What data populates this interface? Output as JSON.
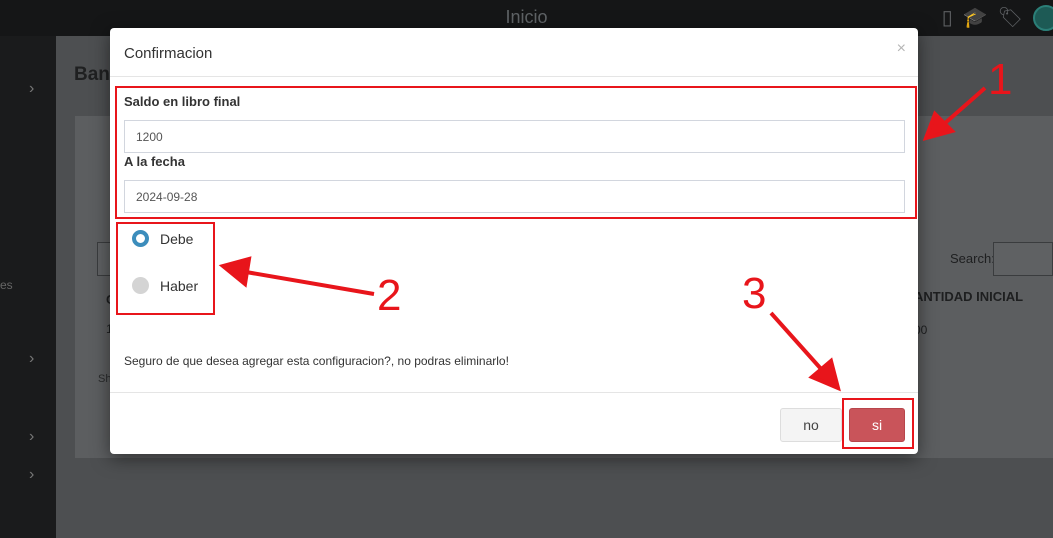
{
  "topbar": {
    "title": "Inicio",
    "icons": [
      "mobile-icon",
      "graduation-cap-icon",
      "tags-icon",
      "user-avatar"
    ]
  },
  "sidebar": {
    "partial_text": "es"
  },
  "background": {
    "page_title_partial": "Ban",
    "search_label": "Search:",
    "column_header_partial": "ANTIDAD INICIAL",
    "cell_value_partial": "00",
    "left_header_partial": "C",
    "left_cell_partial": "1",
    "left_footer_partial": "Sh"
  },
  "modal": {
    "title": "Confirmacion",
    "close_glyph": "×",
    "saldo_label": "Saldo en libro final",
    "saldo_value": "1200",
    "fecha_label": "A la fecha",
    "fecha_value": "2024-09-28",
    "radio_options": [
      {
        "label": "Debe",
        "checked": true
      },
      {
        "label": "Haber",
        "checked": false
      }
    ],
    "confirm_text": "Seguro de que desea agregar esta configuracion?, no podras eliminarlo!",
    "button_no": "no",
    "button_si": "si"
  },
  "annotations": {
    "labels": [
      "1",
      "2",
      "3"
    ],
    "color": "#e8151b"
  },
  "colors": {
    "primary_radio": "#3c8dbc",
    "danger_button": "#c9545a"
  }
}
